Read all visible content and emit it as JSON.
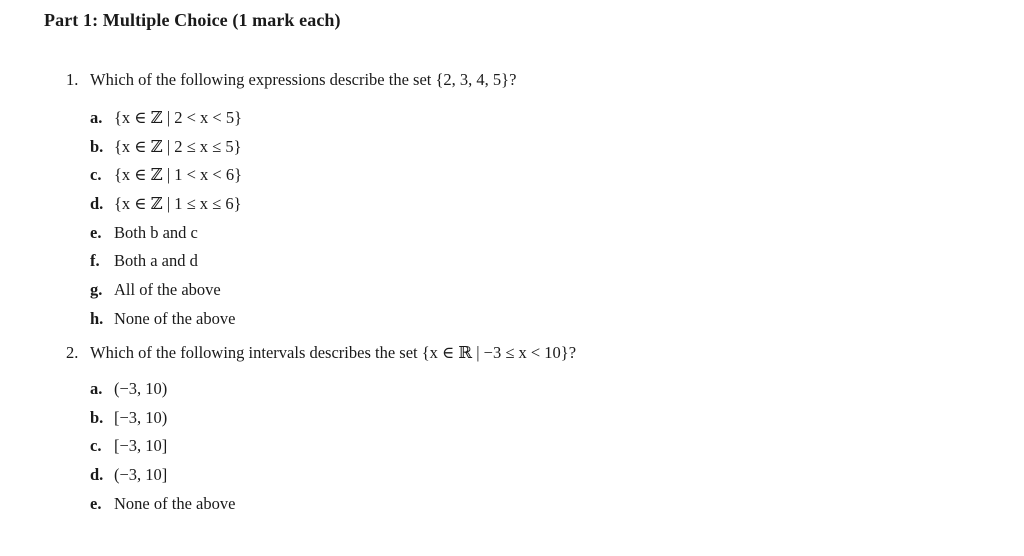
{
  "section": {
    "title": "Part 1: Multiple Choice (1 mark each)"
  },
  "questions": [
    {
      "number": "1.",
      "text": "Which of the following expressions describe the set {2, 3, 4, 5}?",
      "options": [
        {
          "letter": "a.",
          "text": "{x ∈ ℤ | 2 < x < 5}"
        },
        {
          "letter": "b.",
          "text": "{x ∈ ℤ | 2 ≤ x ≤ 5}"
        },
        {
          "letter": "c.",
          "text": "{x ∈ ℤ | 1 < x < 6}"
        },
        {
          "letter": "d.",
          "text": "{x ∈ ℤ | 1 ≤ x ≤ 6}"
        },
        {
          "letter": "e.",
          "text": "Both b and c"
        },
        {
          "letter": "f.",
          "text": "Both a and d"
        },
        {
          "letter": "g.",
          "text": "All of the above"
        },
        {
          "letter": "h.",
          "text": "None of the above"
        }
      ]
    },
    {
      "number": "2.",
      "text": "Which of the following intervals describes the set {x ∈ ℝ | −3 ≤ x < 10}?",
      "options": [
        {
          "letter": "a.",
          "text": "(−3, 10)"
        },
        {
          "letter": "b.",
          "text": "[−3, 10)"
        },
        {
          "letter": "c.",
          "text": "[−3, 10]"
        },
        {
          "letter": "d.",
          "text": "(−3, 10]"
        },
        {
          "letter": "e.",
          "text": "None of the above"
        }
      ]
    }
  ]
}
